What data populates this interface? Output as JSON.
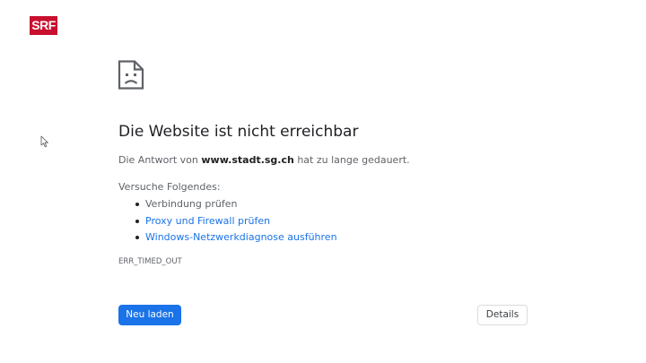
{
  "broadcaster": {
    "logo_text": "SRF"
  },
  "error_page": {
    "title": "Die Website ist nicht erreichbar",
    "message_prefix": "Die Antwort von ",
    "host": "www.stadt.sg.ch",
    "message_suffix": " hat zu lange gedauert.",
    "try_heading": "Versuche Folgendes:",
    "suggestions": [
      {
        "label": "Verbindung prüfen",
        "is_link": false
      },
      {
        "label": "Proxy und Firewall prüfen",
        "is_link": true
      },
      {
        "label": "Windows-Netzwerkdiagnose ausführen",
        "is_link": true
      }
    ],
    "error_code": "ERR_TIMED_OUT",
    "reload_label": "Neu laden",
    "details_label": "Details"
  },
  "colors": {
    "primary_blue": "#1a73e8",
    "srf_red": "#c8102e",
    "text_dark": "#202124",
    "text_grey": "#5f6368"
  },
  "icons": {
    "error_icon": "sad-document-icon",
    "cursor": "mouse-pointer-icon"
  }
}
